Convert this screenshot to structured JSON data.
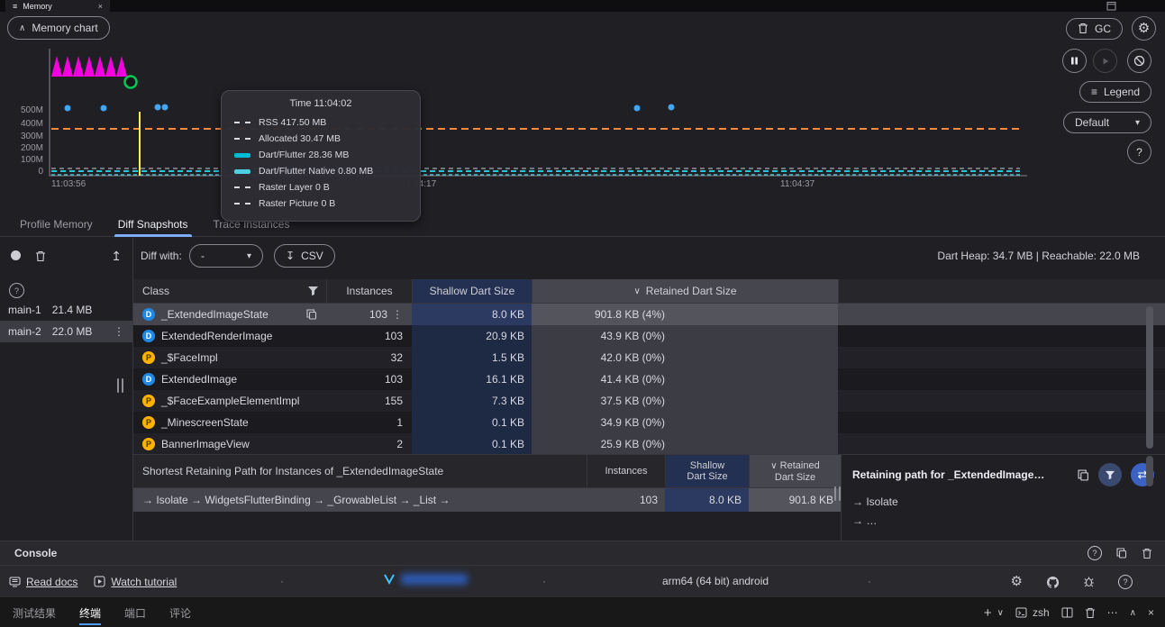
{
  "icons": {
    "menu": "≡",
    "close": "×",
    "chevron_up": "∧",
    "chevron_down": "∨",
    "dropdown": "▾",
    "kebab": "⋮",
    "legend": "≡",
    "upload": "↥",
    "download": "↧",
    "swap": "⇄",
    "ellipsis": "⋯",
    "plus": "+",
    "dot": "·",
    "question": "?",
    "gear": "⚙",
    "sort_down": "∨"
  },
  "editor_tab": {
    "title": "Memory"
  },
  "chart": {
    "toggle_label": "Memory chart",
    "gc_label": "GC",
    "legend_label": "Legend",
    "interval_value": "Default",
    "y_ticks": [
      "500M",
      "400M",
      "300M",
      "200M",
      "100M",
      "0"
    ],
    "x_ticks": [
      "11:03:56",
      "11:04:17",
      "11:04:37"
    ],
    "tooltip": {
      "title": "Time 11:04:02",
      "items": [
        {
          "label": "RSS 417.50 MB",
          "color": "#ff8a3c",
          "style": "dashed"
        },
        {
          "label": "Allocated 30.47 MB",
          "color": "#b0b3b8",
          "style": "dashed"
        },
        {
          "label": "Dart/Flutter 28.36 MB",
          "color": "#00bcd4",
          "style": "solid"
        },
        {
          "label": "Dart/Flutter Native 0.80 MB",
          "color": "#4dd0e1",
          "style": "solid"
        },
        {
          "label": "Raster Layer 0 B",
          "color": "#00e676",
          "style": "dashed"
        },
        {
          "label": "Raster Picture 0 B",
          "color": "#64ffda",
          "style": "dashed"
        }
      ]
    },
    "series_colors": {
      "rss": "#ff8a3c",
      "allocated": "#b0b3b8",
      "dart": "#26c6da",
      "native": "#4dd0e1",
      "raster": "#f400e0",
      "event": "#42a5f5",
      "selection": "#ffee58",
      "gc": "#00c853"
    }
  },
  "tabs": [
    {
      "label": "Profile Memory"
    },
    {
      "label": "Diff Snapshots"
    },
    {
      "label": "Trace Instances"
    }
  ],
  "snapshot_panel": {
    "items": [
      {
        "name": "main-1",
        "size": "21.4 MB"
      },
      {
        "name": "main-2",
        "size": "22.0 MB"
      }
    ]
  },
  "diff_toolbar": {
    "label": "Diff with:",
    "value": "-",
    "csv": "CSV",
    "heap_summary": "Dart Heap: 34.7 MB | Reachable: 22.0 MB"
  },
  "class_table": {
    "columns": {
      "class": "Class",
      "instances": "Instances",
      "shallow": "Shallow Dart Size",
      "retained": "Retained Dart Size"
    },
    "rows": [
      {
        "kind": "D",
        "name": "_ExtendedImageState",
        "instances": "103",
        "shallow": "8.0 KB",
        "retained": "901.8 KB (4%)"
      },
      {
        "kind": "D",
        "name": "ExtendedRenderImage",
        "instances": "103",
        "shallow": "20.9 KB",
        "retained": "43.9 KB (0%)"
      },
      {
        "kind": "P",
        "name": "_$FaceImpl",
        "instances": "32",
        "shallow": "1.5 KB",
        "retained": "42.0 KB (0%)"
      },
      {
        "kind": "D",
        "name": "ExtendedImage",
        "instances": "103",
        "shallow": "16.1 KB",
        "retained": "41.4 KB (0%)"
      },
      {
        "kind": "P",
        "name": "_$FaceExampleElementImpl",
        "instances": "155",
        "shallow": "7.3 KB",
        "retained": "37.5 KB (0%)"
      },
      {
        "kind": "P",
        "name": "_MinescreenState",
        "instances": "1",
        "shallow": "0.1 KB",
        "retained": "34.9 KB (0%)"
      },
      {
        "kind": "P",
        "name": "BannerImageView",
        "instances": "2",
        "shallow": "0.1 KB",
        "retained": "25.9 KB (0%)"
      }
    ]
  },
  "path_table": {
    "title": "Shortest Retaining Path for Instances of _ExtendedImageState",
    "col_instances": "Instances",
    "col_shallow_1": "Shallow",
    "col_shallow_2": "Dart Size",
    "col_retained_1": "Retained",
    "col_retained_2": "Dart Size",
    "row": {
      "path": "→ Isolate → WidgetsFlutterBinding → _GrowableList → _List →",
      "instances": "103",
      "shallow": "8.0 KB",
      "retained": "901.8 KB"
    }
  },
  "retaining_panel": {
    "title": "Retaining path for _ExtendedImage…",
    "lines": [
      "→ Isolate",
      "→ …"
    ]
  },
  "console": {
    "title": "Console"
  },
  "footer": {
    "read_docs": "Read docs",
    "watch_tutorial": "Watch tutorial",
    "device": "arm64 (64 bit) android"
  },
  "bottom_bar": {
    "tabs": [
      "测试结果",
      "终端",
      "端口",
      "评论"
    ],
    "shell": "zsh"
  }
}
